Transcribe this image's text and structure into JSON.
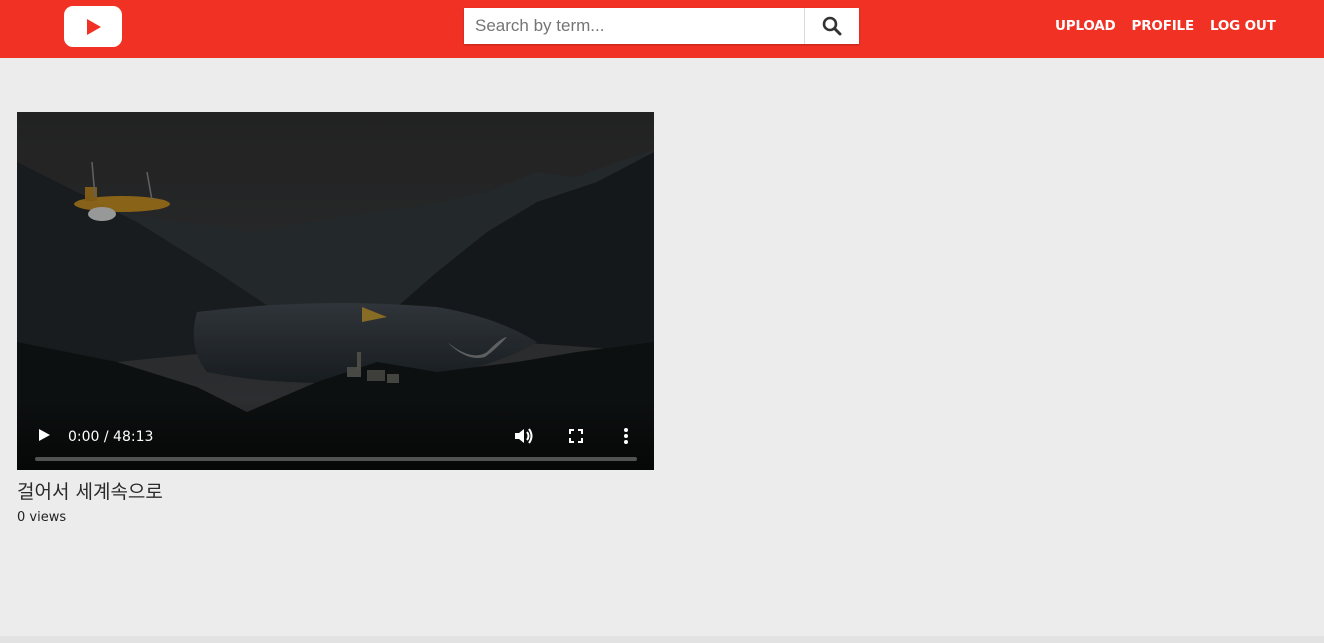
{
  "header": {
    "logo_icon": "play-logo-icon",
    "brand_color": "#f23125",
    "search": {
      "placeholder": "Search by term...",
      "value": "",
      "button_icon": "search-icon"
    },
    "nav": [
      {
        "label": "UPLOAD"
      },
      {
        "label": "PROFILE"
      },
      {
        "label": "LOG OUT"
      }
    ]
  },
  "video": {
    "title": "걸어서 세계속으로",
    "views": "0 views",
    "player": {
      "time_display": "0:00 / 48:13",
      "progress": 0,
      "icons": [
        "play-icon",
        "volume-icon",
        "fullscreen-icon",
        "more-options-icon"
      ]
    }
  }
}
